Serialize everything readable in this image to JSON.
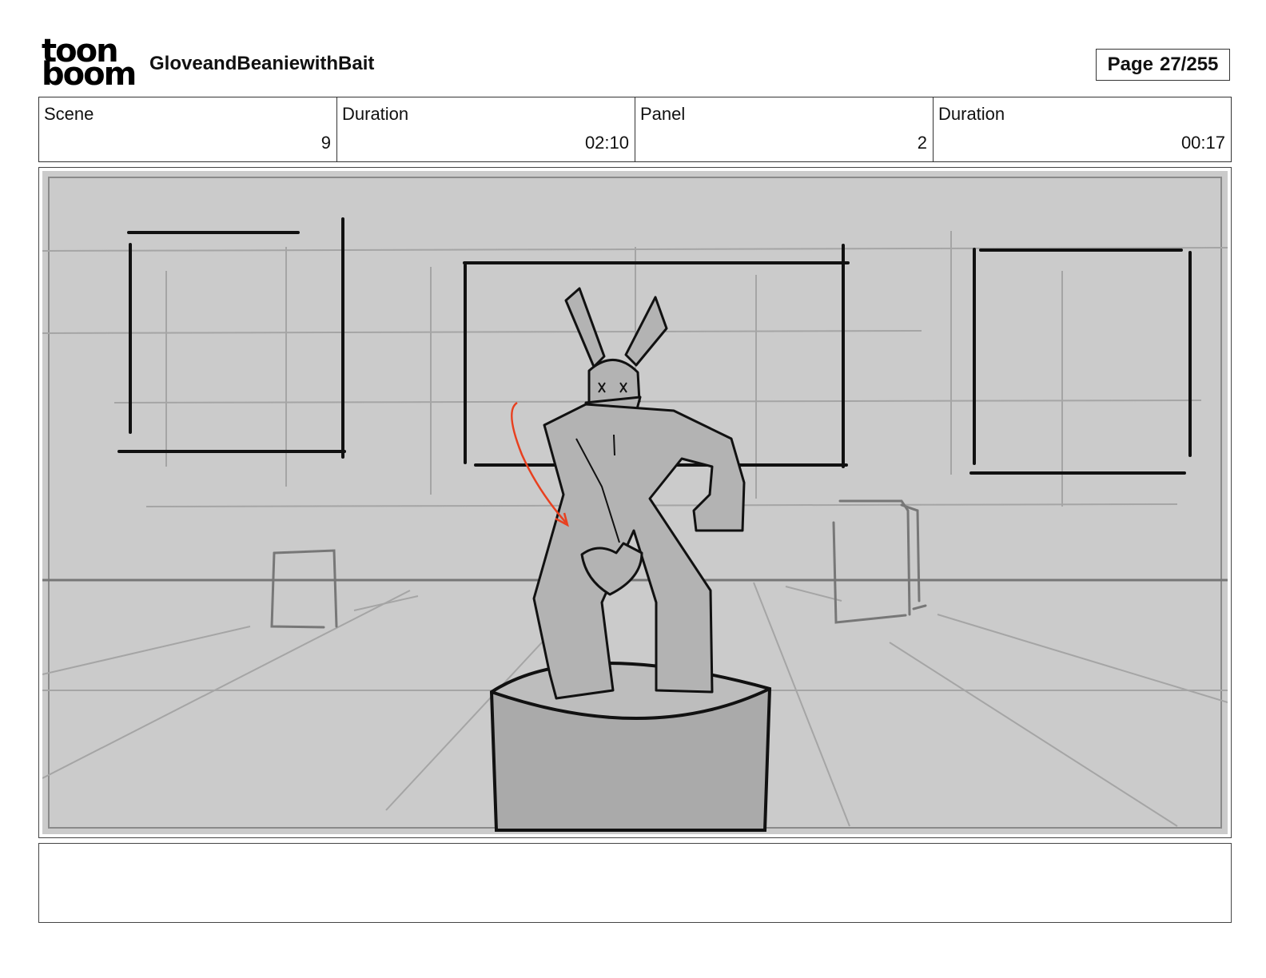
{
  "logo": {
    "line1": "toon",
    "line2": "boom"
  },
  "header": {
    "project_title": "GloveandBeaniewithBait",
    "page_label": "Page",
    "page_value": "27/255"
  },
  "info": {
    "scene_label": "Scene",
    "scene_value": "9",
    "scene_duration_label": "Duration",
    "scene_duration_value": "02:10",
    "panel_label": "Panel",
    "panel_value": "2",
    "panel_duration_label": "Duration",
    "panel_duration_value": "00:17"
  },
  "colors": {
    "sketch_bg": "#cbcbcb",
    "statue_fill": "#b3b3b3",
    "guide_line": "#a5a5a5",
    "motion_arrow": "#e8401f"
  },
  "notes": {
    "text": ""
  }
}
